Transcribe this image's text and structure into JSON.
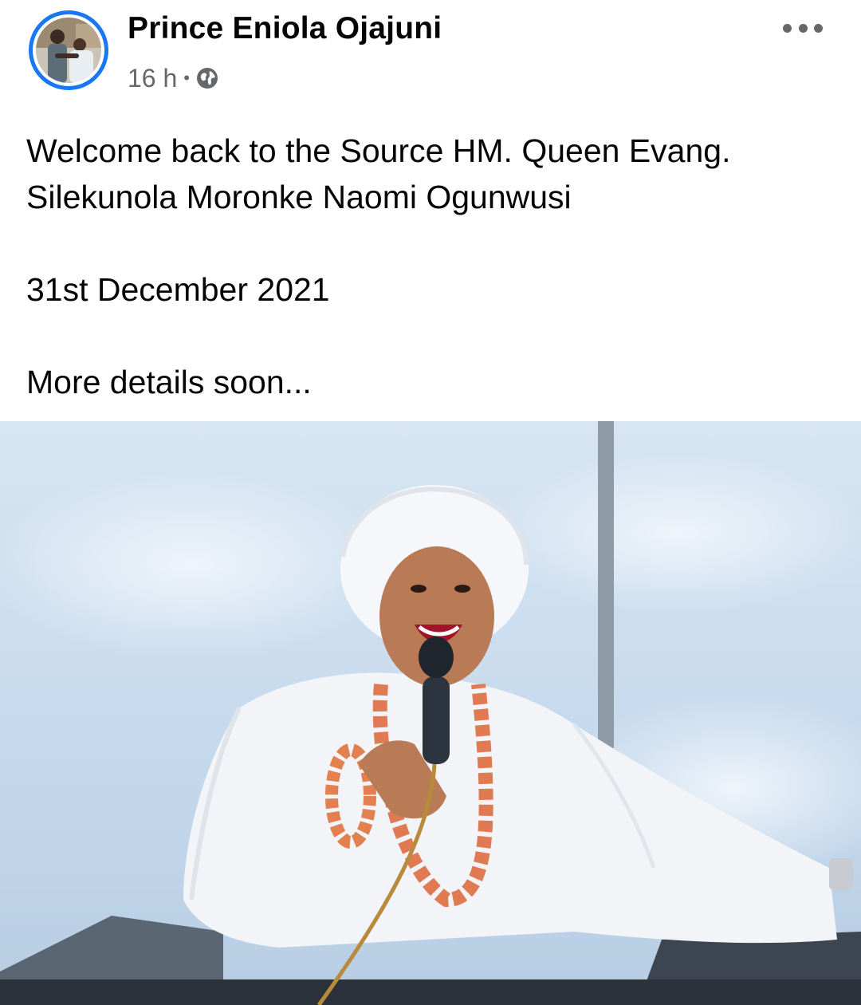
{
  "post": {
    "author": {
      "name": "Prince Eniola Ojajuni",
      "avatar_icon": "profile-photo"
    },
    "meta": {
      "time": "16 h",
      "separator": "•",
      "audience_icon": "globe-icon"
    },
    "more_icon": "ellipsis-icon",
    "text": {
      "line1": "Welcome back to the Source HM. Queen Evang.",
      "line2": "Silekunola Moronke Naomi Ogunwusi",
      "date": "31st December 2021",
      "closing": "More details soon..."
    },
    "photo": {
      "subject": "woman-speaking-into-microphone"
    },
    "colors": {
      "accent_ring": "#1877f2",
      "meta_text": "#65676b",
      "body_text": "#050505"
    }
  }
}
